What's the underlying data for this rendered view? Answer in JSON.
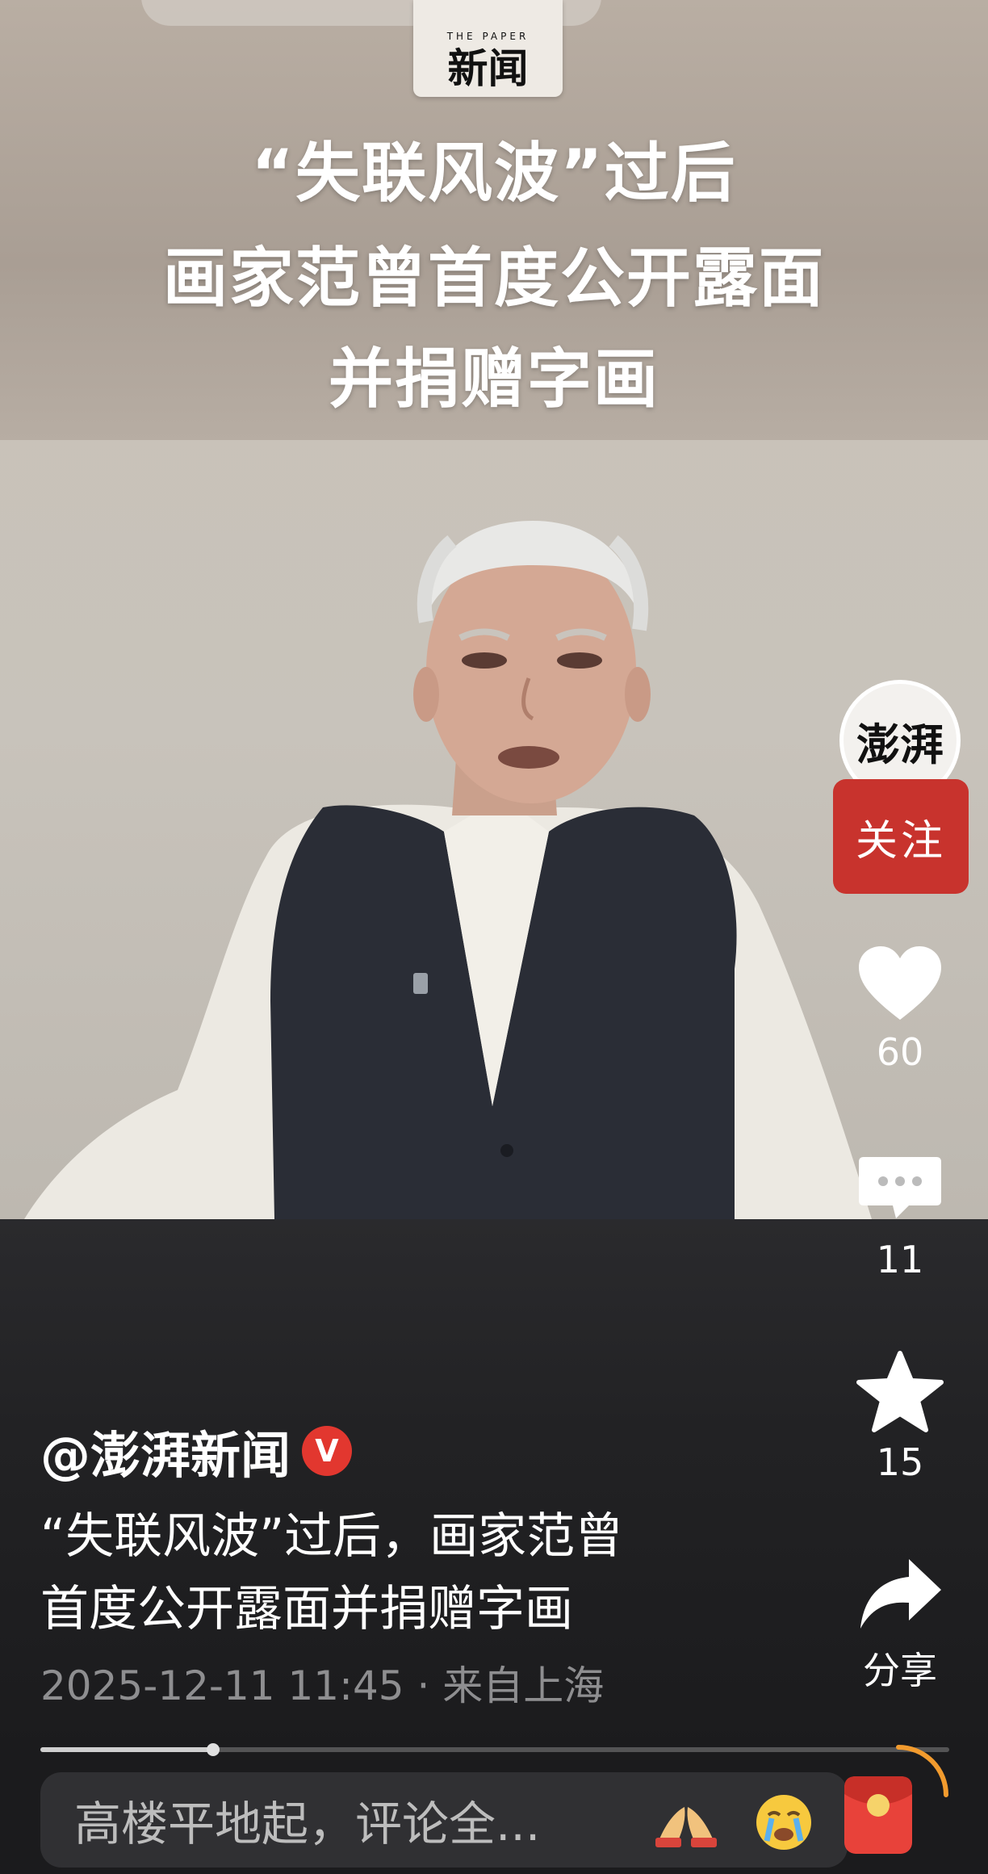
{
  "video": {
    "logo_top": "THE PAPER",
    "logo_text": "新闻",
    "title_lines": [
      "“失联风波”过后",
      "画家范曾首度公开露面",
      "并捐赠字画"
    ]
  },
  "sidebar": {
    "avatar_text": "澎湃",
    "follow_label": "关注",
    "like_count": "60",
    "comment_count": "11",
    "favorite_count": "15",
    "share_label": "分享"
  },
  "post": {
    "author": "@澎湃新闻",
    "verified_badge": "V",
    "caption_line1": "“失联风波”过后，画家范曾",
    "caption_line2": "首度公开露面并捐赠字画",
    "meta": "2025-12-11 11:45 · 来自上海",
    "progress": 0.19
  },
  "comment_bar": {
    "placeholder": "高楼平地起，评论全..."
  },
  "colors": {
    "accent_red": "#c8332d",
    "badge_red": "#e2372f",
    "meta_gray": "#8e8e90"
  },
  "icons": [
    "heart-icon",
    "comment-icon",
    "star-icon",
    "share-icon",
    "clap-emoji-icon",
    "crying-emoji-icon",
    "red-packet-icon"
  ]
}
